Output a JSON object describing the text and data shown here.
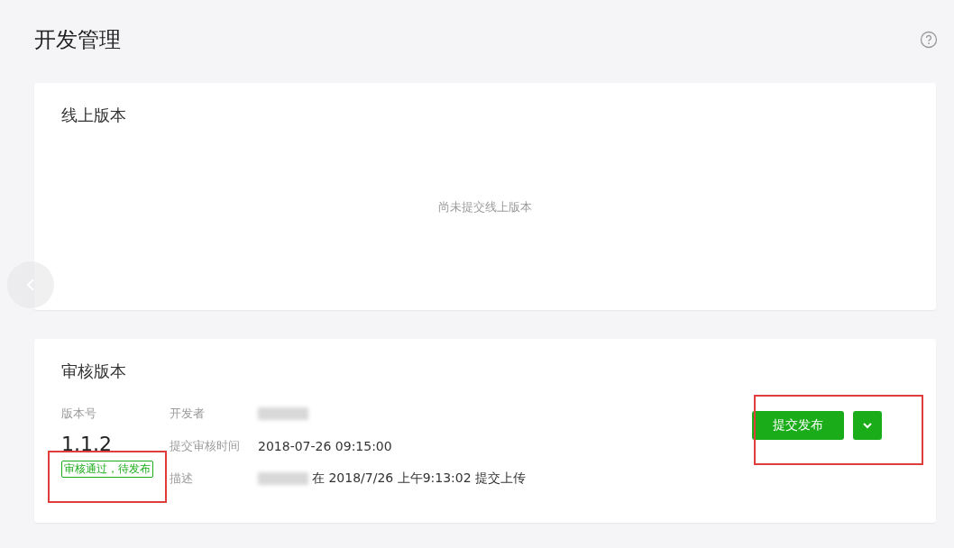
{
  "page": {
    "title": "开发管理"
  },
  "online_version": {
    "title": "线上版本",
    "empty_text": "尚未提交线上版本"
  },
  "review_version": {
    "title": "审核版本",
    "version_label": "版本号",
    "version": "1.1.2",
    "status": "审核通过，待发布",
    "fields": [
      {
        "label": "开发者",
        "kind": "redacted"
      },
      {
        "label": "提交审核时间",
        "kind": "text",
        "value": "2018-07-26 09:15:00"
      },
      {
        "label": "描述",
        "kind": "redacted",
        "value": "在 2018/7/26 上午9:13:02 提交上传"
      }
    ],
    "submit_button": "提交发布",
    "status_highlighted": true,
    "actions_highlighted": true
  }
}
